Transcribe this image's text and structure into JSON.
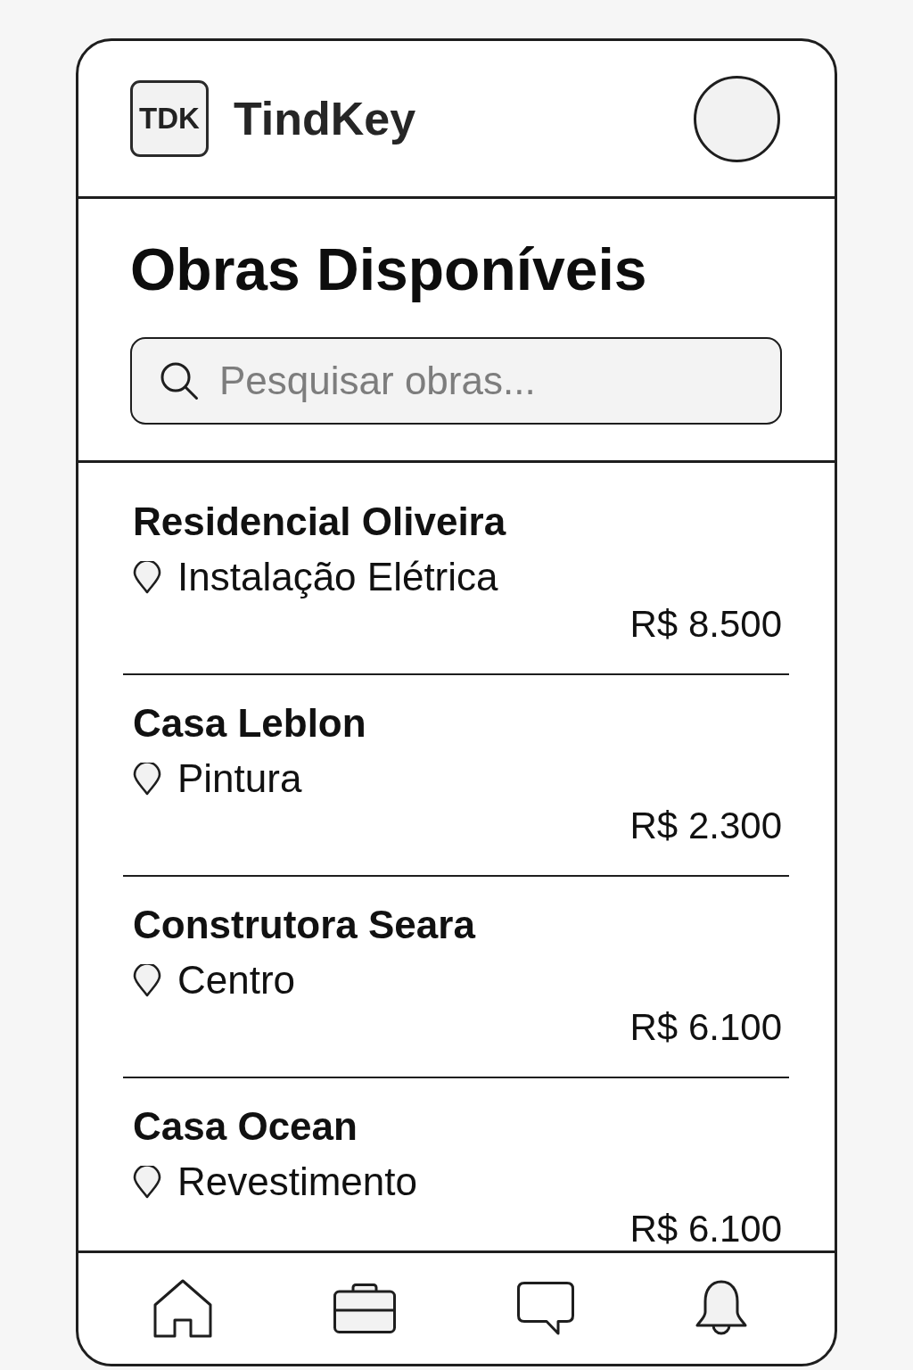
{
  "header": {
    "logo_mark": "TDK",
    "app_name": "TindKey"
  },
  "page_title": "Obras Disponíveis",
  "search": {
    "placeholder": "Pesquisar obras..."
  },
  "jobs": [
    {
      "name": "Residencial Oliveira",
      "service": "Instalação Elétrica",
      "price": "R$ 8.500"
    },
    {
      "name": "Casa Leblon",
      "service": "Pintura",
      "price": "R$ 2.300"
    },
    {
      "name": "Construtora Seara",
      "service": "Centro",
      "price": "R$ 6.100"
    },
    {
      "name": "Casa Ocean",
      "service": "Revestimento",
      "price": "R$ 6.100"
    }
  ],
  "bottom_nav": [
    {
      "kind": "home"
    },
    {
      "kind": "briefcase"
    },
    {
      "kind": "chat"
    },
    {
      "kind": "bell"
    }
  ]
}
